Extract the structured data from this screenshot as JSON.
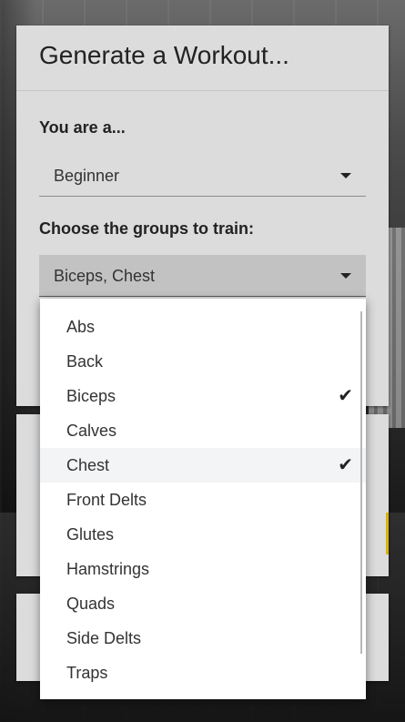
{
  "form": {
    "title": "Generate a Workout...",
    "level_label": "You are a...",
    "level_value": "Beginner",
    "groups_label": "Choose the groups to train:",
    "groups_value": "Biceps, Chest"
  },
  "menu": {
    "items": [
      {
        "label": "Abs",
        "checked": false
      },
      {
        "label": "Back",
        "checked": false
      },
      {
        "label": "Biceps",
        "checked": true
      },
      {
        "label": "Calves",
        "checked": false
      },
      {
        "label": "Chest",
        "checked": true
      },
      {
        "label": "Front Delts",
        "checked": false
      },
      {
        "label": "Glutes",
        "checked": false
      },
      {
        "label": "Hamstrings",
        "checked": false
      },
      {
        "label": "Quads",
        "checked": false
      },
      {
        "label": "Side Delts",
        "checked": false
      },
      {
        "label": "Traps",
        "checked": false
      }
    ],
    "check_glyph": "✔",
    "highlighted_index": 4
  },
  "colors": {
    "card": "#dcdcdc",
    "accent": "#d9b310"
  }
}
